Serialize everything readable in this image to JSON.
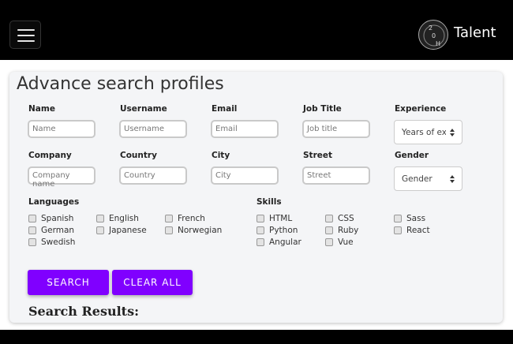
{
  "navbar": {
    "brand": "Talent",
    "logo_text": "20H"
  },
  "search": {
    "title": "Advance search profiles",
    "fields": [
      {
        "label": "Name",
        "placeholder": "Name"
      },
      {
        "label": "Username",
        "placeholder": "Username"
      },
      {
        "label": "Email",
        "placeholder": "Email"
      },
      {
        "label": "Job Title",
        "placeholder": "Job title"
      },
      {
        "label": "Experience",
        "selected": "Years of ex"
      },
      {
        "label": "Company",
        "placeholder": "Company name"
      },
      {
        "label": "Country",
        "placeholder": "Country"
      },
      {
        "label": "City",
        "placeholder": "City"
      },
      {
        "label": "Street",
        "placeholder": "Street"
      },
      {
        "label": "Gender",
        "selected": "Gender"
      }
    ],
    "languages_label": "Languages",
    "languages": [
      "Spanish",
      "English",
      "French",
      "German",
      "Japanese",
      "Norwegian",
      "Swedish"
    ],
    "skills_label": "Skills",
    "skills": [
      "HTML",
      "CSS",
      "Sass",
      "Python",
      "Ruby",
      "React",
      "Angular",
      "Vue"
    ],
    "search_button": "SEARCH",
    "clear_button": "CLEAR ALL",
    "results_title": "Search Results:"
  },
  "colors": {
    "accent": "#8000ff",
    "navbar": "#000000",
    "card": "#f4f5f7"
  }
}
